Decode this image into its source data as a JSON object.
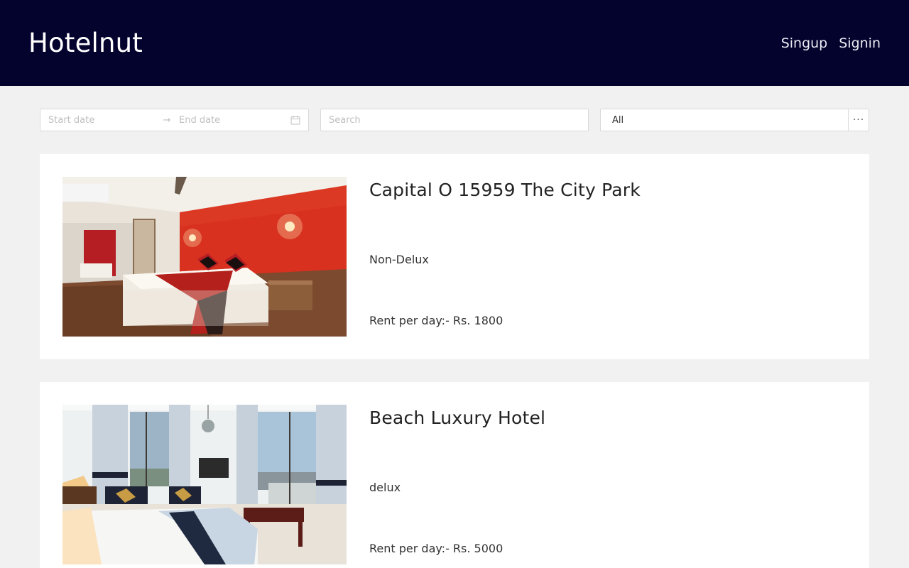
{
  "header": {
    "brand": "Hotelnut",
    "nav": {
      "signup": "Singup",
      "signin": "Signin"
    }
  },
  "filters": {
    "start_placeholder": "Start date",
    "end_placeholder": "End date",
    "search_placeholder": "Search",
    "category_value": "All",
    "more_label": "···"
  },
  "hotels": [
    {
      "name": "Capital O 15959 The City Park",
      "type": "Non-Delux",
      "rent": "Rent per day:- Rs. 1800"
    },
    {
      "name": "Beach Luxury Hotel",
      "type": "delux",
      "rent": "Rent per day:- Rs. 5000"
    }
  ],
  "colors": {
    "header_bg": "#03032e",
    "page_bg": "#f1f1f1",
    "card_bg": "#ffffff"
  },
  "icons": [
    "calendar-icon",
    "arrow-right-icon",
    "more-icon"
  ]
}
